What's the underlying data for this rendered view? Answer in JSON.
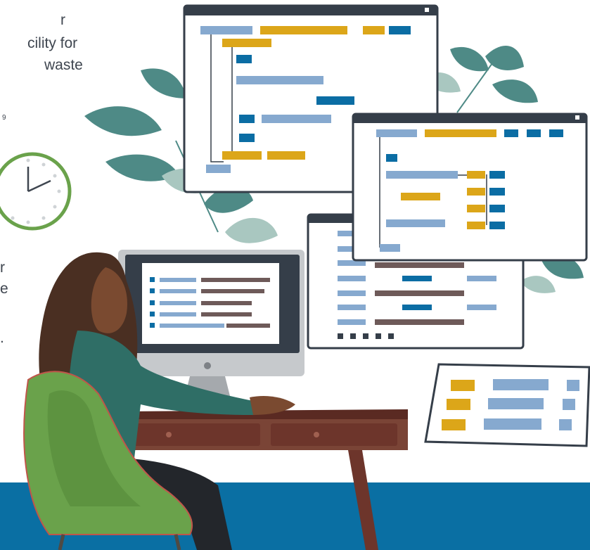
{
  "text_fragments": {
    "line1": "r",
    "line2": "cility for",
    "line3": "waste",
    "line4": "9",
    "line5": "r",
    "line6": "e",
    "line7": "."
  },
  "colors": {
    "floor_blue": "#0a6fa3",
    "ui_blue": "#0b6da4",
    "ui_light_blue": "#86a9cf",
    "ui_gold": "#dca619",
    "ui_brown": "#6e5a59",
    "leaf_teal": "#4e8a86",
    "leaf_pale": "#a9c7c0",
    "chair_green": "#6aa24b",
    "desk_brown": "#6d352b",
    "monitor_dark": "#353e49",
    "clock_green": "#6aa24b"
  }
}
